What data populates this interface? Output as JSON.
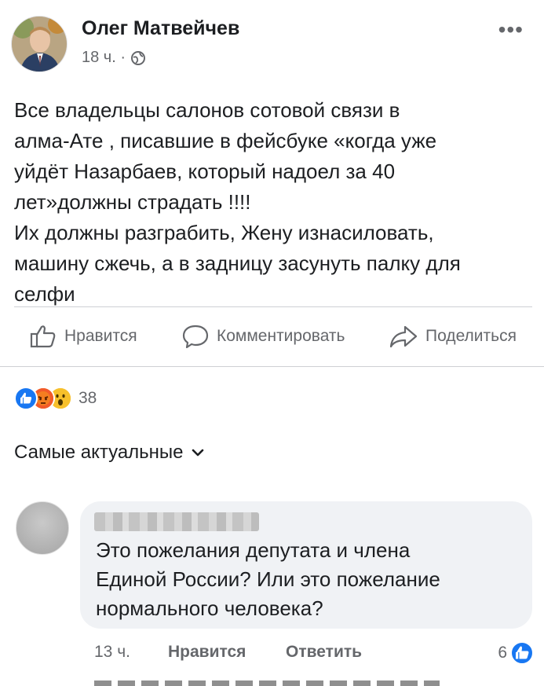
{
  "post": {
    "author": "Олег Матвейчев",
    "time": "18 ч. ·",
    "more": "•••",
    "text_lines": [
      "Все владельцы салонов сотовой связи в",
      "алма-Ате , писавшие в фейсбуке  «когда уже",
      "уйдёт Назарбаев,  который надоел за 40",
      "лет»должны страдать !!!!",
      "Их должны разграбить, Жену изнасиловать,",
      "машину сжечь,  а в задницу засунуть палку для",
      "селфи"
    ]
  },
  "actions": {
    "like": "Нравится",
    "comment": "Комментировать",
    "share": "Поделиться"
  },
  "reactions": {
    "count": "38",
    "types": [
      "like",
      "angry",
      "wow"
    ],
    "colors": {
      "like": "#1877f2",
      "angry": "#e9710f",
      "wow": "#f7b928"
    }
  },
  "sort": {
    "label": "Самые актуальные"
  },
  "comment": {
    "text_lines": [
      "Это пожелания депутата и члена",
      "Единой России? Или это пожелание",
      "нормального человека?"
    ],
    "time": "13 ч.",
    "like": "Нравится",
    "reply": "Ответить",
    "reaction_count": "6"
  }
}
